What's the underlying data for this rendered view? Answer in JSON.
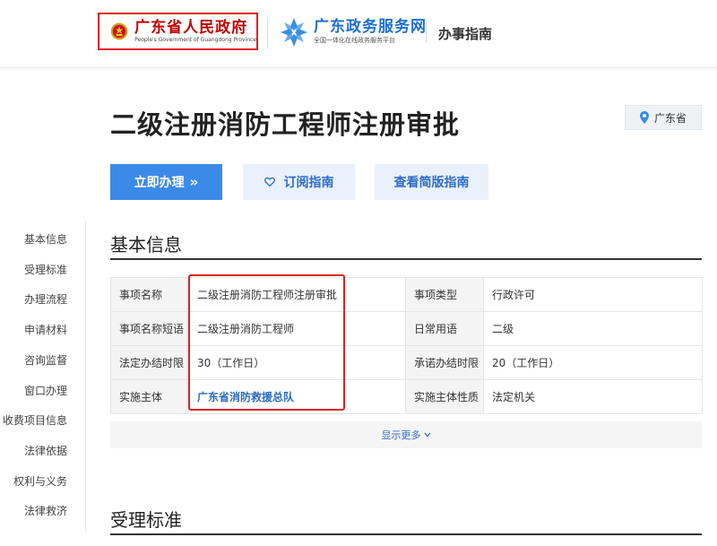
{
  "header": {
    "gov_logo_title": "广东省人民政府",
    "gov_logo_subtitle": "People's Government of Guangdong Province",
    "service_title": "广东政务服务网",
    "service_subtitle": "全国一体化在线政务服务平台",
    "nav_label": "办事指南"
  },
  "page": {
    "title": "二级注册消防工程师注册审批",
    "region": "广东省"
  },
  "actions": {
    "apply_label": "立即办理",
    "apply_arrow": "»",
    "subscribe_label": "订阅指南",
    "brief_label": "查看简版指南"
  },
  "sidebar": {
    "items": [
      {
        "label": "基本信息"
      },
      {
        "label": "受理标准"
      },
      {
        "label": "办理流程"
      },
      {
        "label": "申请材料"
      },
      {
        "label": "咨询监督"
      },
      {
        "label": "窗口办理"
      },
      {
        "label": "收费项目信息"
      },
      {
        "label": "法律依据"
      },
      {
        "label": "权利与义务"
      },
      {
        "label": "法律救济"
      }
    ]
  },
  "basic_info": {
    "heading": "基本信息",
    "rows": [
      {
        "l1": "事项名称",
        "v1": "二级注册消防工程师注册审批",
        "l2": "事项类型",
        "v2": "行政许可"
      },
      {
        "l1": "事项名称短语",
        "v1": "二级注册消防工程师",
        "l2": "日常用语",
        "v2": "二级"
      },
      {
        "l1": "法定办结时限",
        "v1": "30（工作日）",
        "l2": "承诺办结时限",
        "v2": "20（工作日）"
      },
      {
        "l1": "实施主体",
        "v1": "广东省消防救援总队",
        "l2": "实施主体性质",
        "v2": "法定机关"
      }
    ],
    "show_more": "显示更多"
  },
  "acceptance": {
    "heading": "受理标准"
  },
  "colors": {
    "primary": "#3c8ae8",
    "link": "#2e6cc7",
    "highlight": "#e02020",
    "gov_red": "#c00000"
  },
  "icons": [
    "national-emblem-icon",
    "gd-service-logo-icon",
    "location-pin-icon",
    "heart-icon",
    "chevron-down-icon"
  ]
}
